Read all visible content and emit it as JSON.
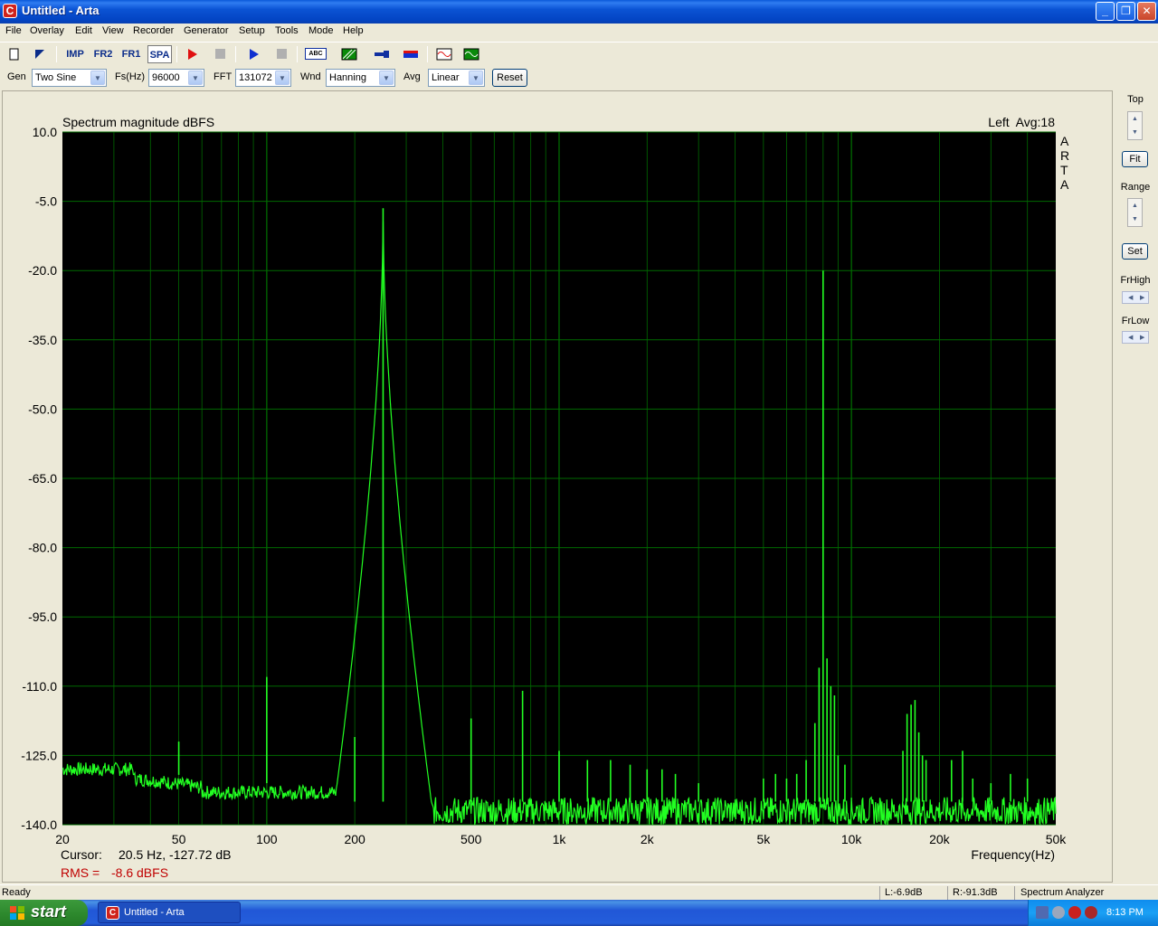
{
  "window": {
    "title": "Untitled - Arta",
    "app_icon": "C"
  },
  "menu": [
    "File",
    "Overlay",
    "Edit",
    "View",
    "Recorder",
    "Generator",
    "Setup",
    "Tools",
    "Mode",
    "Help"
  ],
  "toolbar": {
    "imp": "IMP",
    "fr2": "FR2",
    "fr1": "FR1",
    "spa": "SPA",
    "abc": "ABC"
  },
  "params": {
    "gen_label": "Gen",
    "gen_value": "Two Sine",
    "fs_label": "Fs(Hz)",
    "fs_value": "96000",
    "fft_label": "FFT",
    "fft_value": "131072",
    "wnd_label": "Wnd",
    "wnd_value": "Hanning",
    "avg_label": "Avg",
    "avg_value": "Linear",
    "reset_label": "Reset"
  },
  "graph": {
    "title": "Spectrum magnitude dBFS",
    "channel_info": "Left  Avg:18",
    "side_label": [
      "A",
      "R",
      "T",
      "A"
    ],
    "cursor_label": "Cursor:",
    "cursor_value": "20.5 Hz, -127.72 dB",
    "rms_label": "RMS =",
    "rms_value": "-8.6 dBFS",
    "colors": {
      "background": "#000000",
      "grid": "#006a00",
      "trace": "#22ff22",
      "rms": "#c00000"
    }
  },
  "chart_data": {
    "type": "line",
    "title": "Spectrum magnitude dBFS",
    "xlabel": "Frequency(Hz)",
    "ylabel": "",
    "xscale": "log",
    "xlim": [
      20,
      50000
    ],
    "ylim": [
      -140,
      10
    ],
    "yticks": [
      10.0,
      -5.0,
      -20.0,
      -35.0,
      -50.0,
      -65.0,
      -80.0,
      -95.0,
      -110.0,
      -125.0,
      -140.0
    ],
    "ytick_labels": [
      "10.0",
      "-5.0",
      "-20.0",
      "-35.0",
      "-50.0",
      "-65.0",
      "-80.0",
      "-95.0",
      "-110.0",
      "-125.0",
      "-140.0"
    ],
    "xticks": [
      20,
      50,
      100,
      200,
      500,
      1000,
      2000,
      5000,
      10000,
      20000,
      50000
    ],
    "xtick_labels": [
      "20",
      "50",
      "100",
      "200",
      "500",
      "1k",
      "2k",
      "5k",
      "10k",
      "20k",
      "50k"
    ],
    "grid": true,
    "peaks": [
      {
        "f": 50,
        "db": -122
      },
      {
        "f": 100,
        "db": -108
      },
      {
        "f": 200,
        "db": -121
      },
      {
        "f": 250,
        "db": -6.5
      },
      {
        "f": 500,
        "db": -117
      },
      {
        "f": 750,
        "db": -111
      },
      {
        "f": 1000,
        "db": -124
      },
      {
        "f": 1250,
        "db": -126
      },
      {
        "f": 1500,
        "db": -126
      },
      {
        "f": 1750,
        "db": -127
      },
      {
        "f": 2000,
        "db": -128
      },
      {
        "f": 2250,
        "db": -128
      },
      {
        "f": 2500,
        "db": -129
      },
      {
        "f": 3000,
        "db": -131
      },
      {
        "f": 5000,
        "db": -130
      },
      {
        "f": 5500,
        "db": -129
      },
      {
        "f": 6000,
        "db": -130
      },
      {
        "f": 6500,
        "db": -129
      },
      {
        "f": 7000,
        "db": -126
      },
      {
        "f": 7500,
        "db": -118
      },
      {
        "f": 7750,
        "db": -106
      },
      {
        "f": 8000,
        "db": -20
      },
      {
        "f": 8250,
        "db": -104
      },
      {
        "f": 8500,
        "db": -110
      },
      {
        "f": 8750,
        "db": -112
      },
      {
        "f": 9000,
        "db": -125
      },
      {
        "f": 9500,
        "db": -127
      },
      {
        "f": 15000,
        "db": -124
      },
      {
        "f": 15500,
        "db": -116
      },
      {
        "f": 16000,
        "db": -114
      },
      {
        "f": 16500,
        "db": -113
      },
      {
        "f": 17000,
        "db": -120
      },
      {
        "f": 17500,
        "db": -125
      },
      {
        "f": 18000,
        "db": -126
      },
      {
        "f": 22000,
        "db": -126
      },
      {
        "f": 24000,
        "db": -124
      },
      {
        "f": 26000,
        "db": -130
      },
      {
        "f": 30000,
        "db": -131
      },
      {
        "f": 35000,
        "db": -129
      },
      {
        "f": 40000,
        "db": -130
      }
    ]
  },
  "right_panel": {
    "top_label": "Top",
    "fit_label": "Fit",
    "range_label": "Range",
    "set_label": "Set",
    "frhigh_label": "FrHigh",
    "frlow_label": "FrLow"
  },
  "status": {
    "ready": "Ready",
    "left_level": "L:-6.9dB",
    "right_level": "R:-91.3dB",
    "mode": "Spectrum Analyzer"
  },
  "taskbar": {
    "start_label": "start",
    "task_label": "Untitled - Arta",
    "clock": "8:13 PM"
  }
}
